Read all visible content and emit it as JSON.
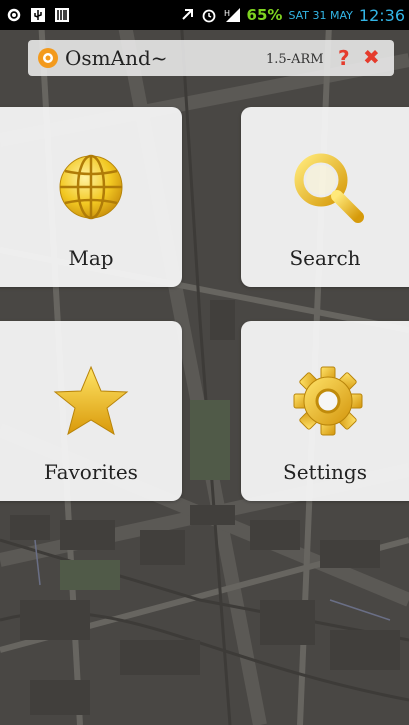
{
  "status_bar": {
    "icons": [
      "settings-icon",
      "usb-icon",
      "barcode-icon",
      "rotate-icon",
      "alarm-icon",
      "signal-icon"
    ],
    "battery": "65%",
    "date": "SAT 31 MAY",
    "time": "12:36",
    "battery_color": "#7ed321",
    "accent_color": "#33b5e5"
  },
  "title_bar": {
    "app_name": "OsmAnd~",
    "version": "1.5-ARM",
    "help_label": "?",
    "close_label": "✖",
    "logo_icon": "map-pin-icon",
    "button_color": "#e53b2c"
  },
  "menu": {
    "map": {
      "label": "Map",
      "icon": "globe-icon"
    },
    "search": {
      "label": "Search",
      "icon": "magnifier-icon"
    },
    "favorites": {
      "label": "Favorites",
      "icon": "star-icon"
    },
    "settings": {
      "label": "Settings",
      "icon": "gear-icon"
    }
  }
}
